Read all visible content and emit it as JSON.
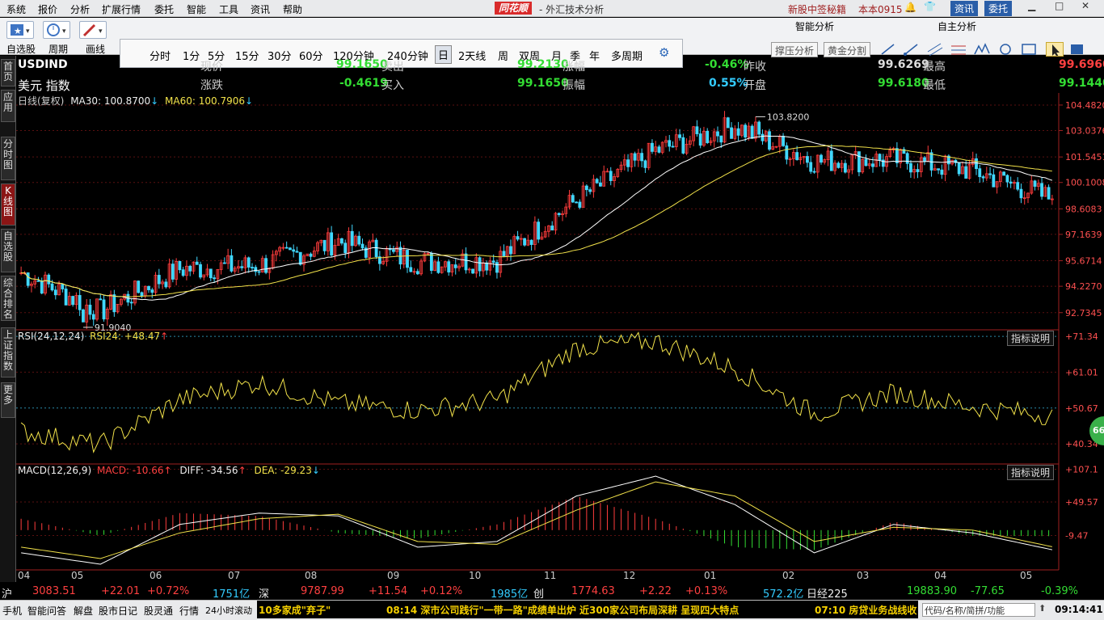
{
  "menubar": {
    "items": [
      "系统",
      "报价",
      "分析",
      "扩展行情",
      "委托",
      "智能",
      "工具",
      "资讯",
      "帮助"
    ],
    "brand": "同花顺",
    "brand_sub": "- 外汇技术分析",
    "notice": "新股中签秘籍",
    "user": "本本0915",
    "news_btn": "资讯",
    "trade_btn": "委托"
  },
  "toolbar": {
    "left_labels": [
      "自选股",
      "周期",
      "画线"
    ],
    "periods": [
      "分时",
      "1分",
      "5分",
      "15分",
      "30分",
      "60分",
      "120分钟",
      "240分钟",
      "日",
      "2天线",
      "周",
      "双周",
      "月",
      "季",
      "年",
      "多周期"
    ],
    "selected_period": "日",
    "smart_title": "智能分析",
    "self_title": "自主分析",
    "smart_buttons": [
      "撑压分析",
      "黄金分割"
    ],
    "draw_tools": [
      "line-tool-icon",
      "ray-tool-icon",
      "channel-tool-icon",
      "parallel-tool-icon",
      "wave-tool-icon",
      "circle-tool-icon",
      "rect-tool-icon",
      "cursor-icon",
      "color-icon"
    ]
  },
  "left_rail": [
    "首页",
    "应用",
    "分时图",
    "K线图",
    "自选股",
    "综合排名",
    "上证指数",
    "更多"
  ],
  "left_rail_active": "K线图",
  "quote": {
    "code": "USDIND",
    "name": "美元 指数",
    "row1": [
      {
        "label": "现价",
        "value": "99.1650",
        "color": "#33dd33"
      },
      {
        "label": "卖出",
        "value": "99.2130",
        "color": "#33dd33"
      },
      {
        "label": "涨幅",
        "value": "-0.46%",
        "color": "#33dd33"
      },
      {
        "label": "昨收",
        "value": "99.6269",
        "color": "#dddddd"
      },
      {
        "label": "最高",
        "value": "99.6960",
        "color": "#ff4040"
      }
    ],
    "row2": [
      {
        "label": "涨跌",
        "value": "-0.4619",
        "color": "#33dd33"
      },
      {
        "label": "买入",
        "value": "99.1650",
        "color": "#33dd33"
      },
      {
        "label": "振幅",
        "value": "0.55%",
        "color": "#33ccff"
      },
      {
        "label": "开盘",
        "value": "99.6180",
        "color": "#33dd33"
      },
      {
        "label": "最低",
        "value": "99.1440",
        "color": "#33dd33"
      }
    ]
  },
  "kline": {
    "header_prefix": "日线(复权)",
    "ma30_label": "MA30: 100.8700",
    "ma60_label": "MA60: 100.7906",
    "high_mark": "103.8200",
    "low_mark": "91.9040",
    "y_ticks": [
      "104.4820",
      "103.0376",
      "101.5451",
      "100.1008",
      "98.6083",
      "97.1639",
      "95.6714",
      "94.2270",
      "92.7345"
    ]
  },
  "rsi": {
    "header": "RSI(24,12,24)",
    "value_label": "RSI24: +48.47",
    "button": "指标说明",
    "y_ticks": [
      "+71.34",
      "+61.01",
      "+50.67",
      "+40.34"
    ],
    "badge": "66"
  },
  "macd": {
    "header": "MACD(12,26,9)",
    "macd_label": "MACD: -10.66",
    "diff_label": "DIFF: -34.56",
    "dea_label": "DEA: -29.23",
    "button": "指标说明",
    "y_ticks": [
      "+107.1",
      "+49.57",
      "-9.47"
    ]
  },
  "x_axis": [
    "04",
    "05",
    "06",
    "07",
    "08",
    "09",
    "10",
    "11",
    "12",
    "01",
    "02",
    "03",
    "04",
    "05"
  ],
  "chart_data": [
    {
      "type": "candlestick",
      "title": "USDIND 日线(复权)",
      "x": [
        "04",
        "05",
        "06",
        "07",
        "08",
        "09",
        "10",
        "11",
        "12",
        "01",
        "02",
        "03",
        "04",
        "05"
      ],
      "close_approx": [
        95.0,
        92.8,
        95.2,
        95.4,
        96.8,
        95.6,
        95.7,
        99.1,
        101.9,
        103.3,
        101.3,
        101.4,
        100.8,
        99.17
      ],
      "ylim": [
        91.9,
        104.48
      ],
      "high": 103.82,
      "low": 91.904,
      "series": [
        {
          "name": "MA30",
          "last": 100.87
        },
        {
          "name": "MA60",
          "last": 100.7906
        }
      ]
    },
    {
      "type": "line",
      "title": "RSI(24,12,24)",
      "x": [
        "04",
        "05",
        "06",
        "07",
        "08",
        "09",
        "10",
        "11",
        "12",
        "01",
        "02",
        "03",
        "04",
        "05"
      ],
      "series": [
        {
          "name": "RSI24",
          "values": [
            44,
            40,
            53,
            58,
            52,
            50,
            53,
            68,
            70,
            62,
            49,
            55,
            51,
            48.47
          ]
        }
      ],
      "ylim": [
        35,
        73
      ]
    },
    {
      "type": "bar",
      "title": "MACD(12,26,9)",
      "x": [
        "04",
        "05",
        "06",
        "07",
        "08",
        "09",
        "10",
        "11",
        "12",
        "01",
        "02",
        "03",
        "04",
        "05"
      ],
      "series": [
        {
          "name": "MACD",
          "values": [
            20,
            -10,
            30,
            25,
            -5,
            -15,
            10,
            60,
            20,
            -30,
            -35,
            15,
            -10,
            -10.66
          ]
        },
        {
          "name": "DIFF",
          "values": [
            -40,
            -60,
            10,
            30,
            25,
            -30,
            -20,
            60,
            95,
            45,
            -40,
            10,
            -5,
            -34.56
          ]
        },
        {
          "name": "DEA",
          "values": [
            -30,
            -50,
            -5,
            20,
            28,
            -20,
            -25,
            35,
            85,
            60,
            -20,
            5,
            0,
            -29.23
          ]
        }
      ],
      "ylim": [
        -70,
        115
      ]
    }
  ],
  "ticker": {
    "sh_label": "沪",
    "sh_value": "3083.51",
    "sh_change": "+22.01",
    "sh_pct": "+0.72%",
    "sh_amount": "1751亿",
    "sz_label": "深",
    "sz_value": "9787.99",
    "sz_change": "+11.54",
    "sz_pct": "+0.12%",
    "sz_amount": "1985亿",
    "cy_label": "创",
    "cy_value": "1774.63",
    "cy_change": "+2.22",
    "cy_pct": "+0.13%",
    "cy_amount": "572.2亿",
    "nk_label": "日经225",
    "nk_value": "19883.90",
    "nk_change": "-77.65",
    "nk_pct": "-0.39%"
  },
  "status": {
    "items": [
      "手机",
      "智能问答",
      "解盘",
      "股市日记",
      "股灵通",
      "行情"
    ],
    "scroll_label": "24小时滚动",
    "headline1": "10多家成\"弃子\"",
    "headline2": "08:14 深市公司践行\"一带一路\"成绩单出炉 近300家公司布局深耕 呈现四大特点",
    "headline3": "07:10 房贷业务战线收",
    "search": "代码/名称/简拼/功能",
    "time": "09:14:41"
  }
}
